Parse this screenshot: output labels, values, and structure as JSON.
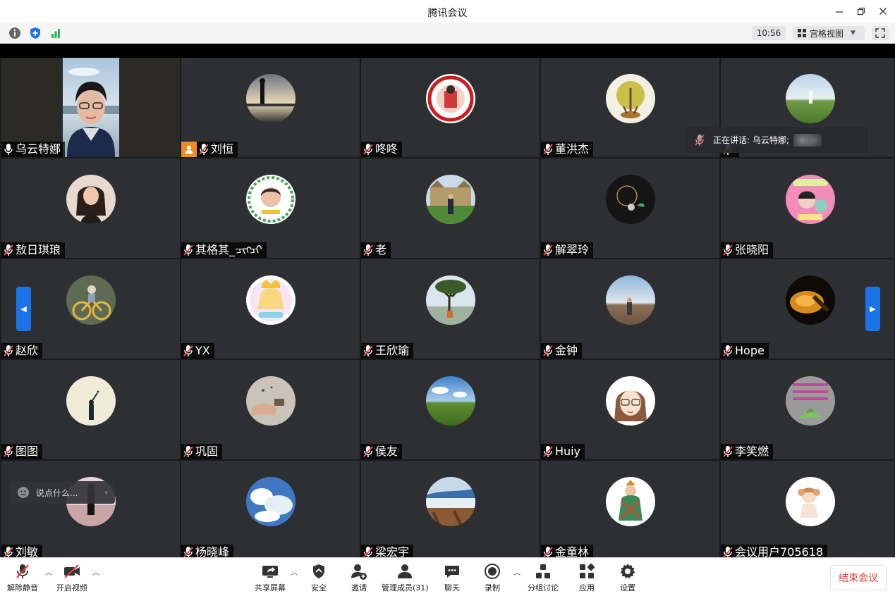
{
  "window": {
    "title": "腾讯会议"
  },
  "infobar": {
    "time": "10:56",
    "view_label": "宫格视图"
  },
  "speaking": {
    "text": "正在讲话: 乌云特娜;"
  },
  "chat": {
    "placeholder": "说点什么..."
  },
  "participants": [
    {
      "name": "乌云特娜"
    },
    {
      "name": "刘恒"
    },
    {
      "name": "咚咚"
    },
    {
      "name": "董洪杰"
    },
    {
      "name": ""
    },
    {
      "name": "敖日琪琅"
    },
    {
      "name": "其格其_ᠴᠢᠭᠴᠢ"
    },
    {
      "name": "老"
    },
    {
      "name": "解翠玲"
    },
    {
      "name": "张晓阳"
    },
    {
      "name": "赵欣"
    },
    {
      "name": "YX"
    },
    {
      "name": "王欣瑜"
    },
    {
      "name": "金钟"
    },
    {
      "name": "Hope"
    },
    {
      "name": "图图"
    },
    {
      "name": "巩固"
    },
    {
      "name": "侯友"
    },
    {
      "name": "Huiy"
    },
    {
      "name": "李笑燃"
    },
    {
      "name": "刘敏"
    },
    {
      "name": "杨晓峰"
    },
    {
      "name": "梁宏宇"
    },
    {
      "name": "金童林"
    },
    {
      "name": "会议用户705618"
    }
  ],
  "toolbar": {
    "unmute": "解除静音",
    "video": "开启视频",
    "share": "共享屏幕",
    "security": "安全",
    "invite": "邀请",
    "members": "管理成员(31)",
    "chat": "聊天",
    "record": "录制",
    "breakout": "分组讨论",
    "apps": "应用",
    "settings": "设置",
    "end": "结束会议"
  },
  "colors": {
    "accent": "#1a73e8",
    "end_red": "#e83a32",
    "host_orange": "#f28b22"
  }
}
